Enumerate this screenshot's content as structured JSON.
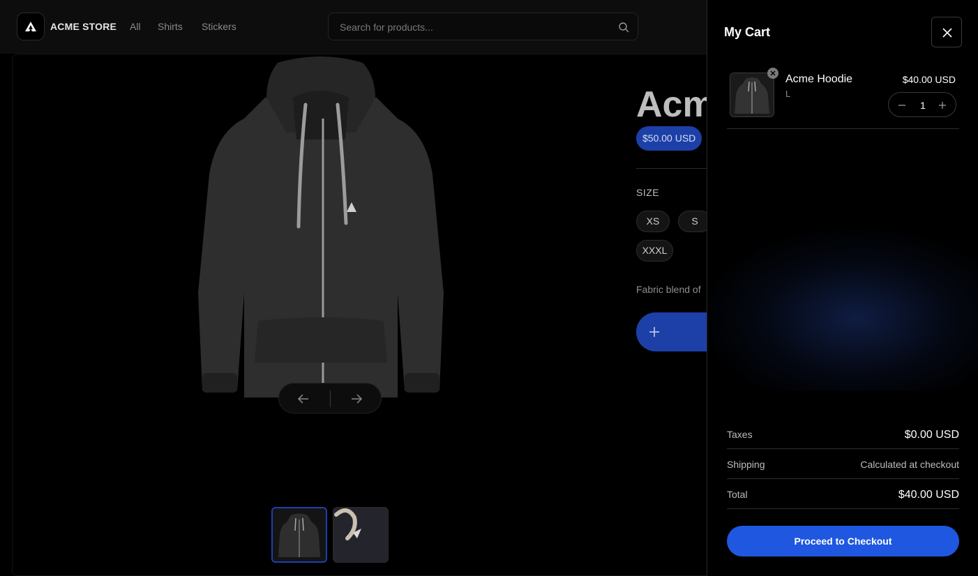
{
  "header": {
    "brand": "ACME STORE",
    "nav": [
      "All",
      "Shirts",
      "Stickers"
    ],
    "search_placeholder": "Search for products..."
  },
  "product": {
    "title": "Acm",
    "price": "$50.00 USD",
    "size_label": "SIZE",
    "sizes": [
      "XS",
      "S",
      "XXXL"
    ],
    "description": "Fabric blend of",
    "thumbnails": [
      "hoodie-front",
      "hoodie-detail"
    ]
  },
  "cart": {
    "title": "My Cart",
    "item": {
      "name": "Acme Hoodie",
      "variant": "L",
      "price": "$40.00 USD",
      "quantity": "1"
    },
    "summary": {
      "taxes_label": "Taxes",
      "taxes_value": "$0.00 USD",
      "shipping_label": "Shipping",
      "shipping_value": "Calculated at checkout",
      "total_label": "Total",
      "total_value": "$40.00 USD"
    },
    "checkout_label": "Proceed to Checkout"
  },
  "colors": {
    "accent": "#1f57e0",
    "price_badge": "#1d3fa8",
    "background": "#000000"
  },
  "icons": [
    "acme-logo-icon",
    "search-icon",
    "arrow-left-icon",
    "arrow-right-icon",
    "plus-icon",
    "close-icon",
    "remove-icon",
    "minus-icon"
  ]
}
